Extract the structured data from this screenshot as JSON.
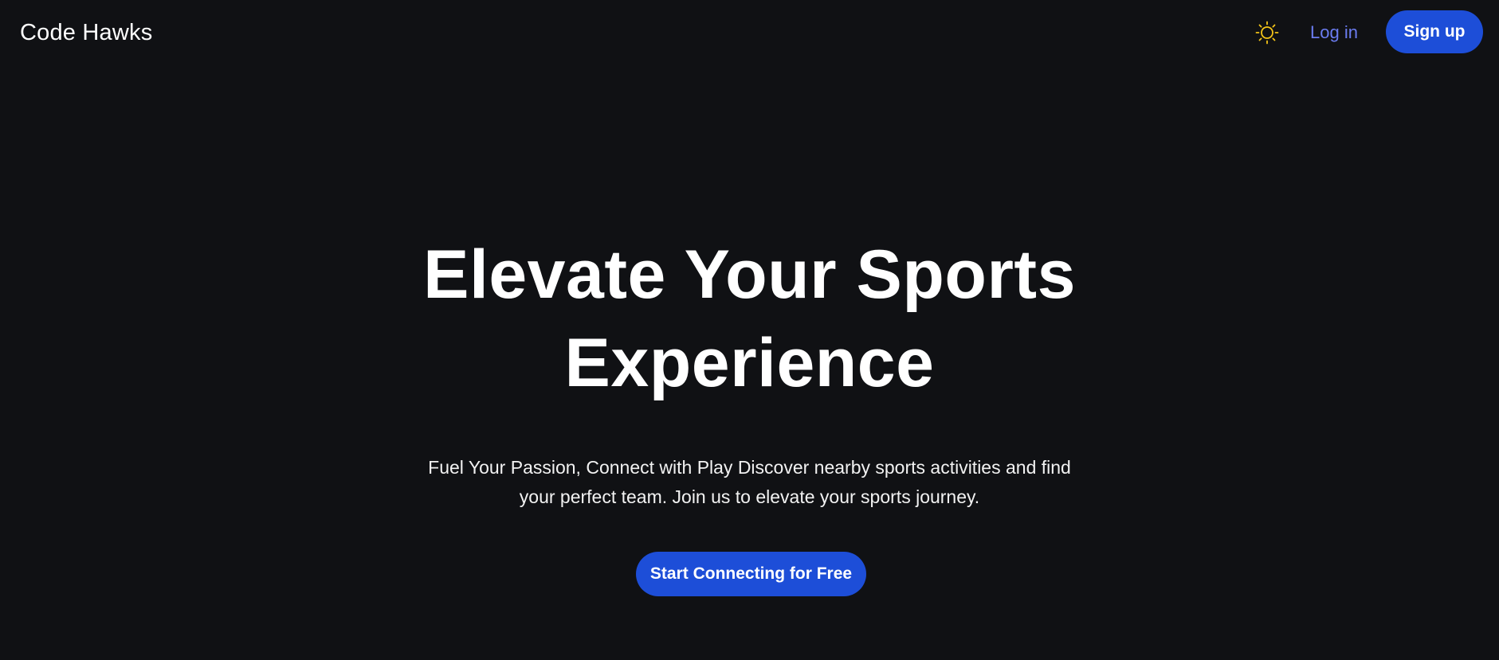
{
  "header": {
    "brand": "Code Hawks",
    "theme_toggle_icon": "sun-icon",
    "theme_icon_color": "#f5c518",
    "login_label": "Log in",
    "signup_label": "Sign up"
  },
  "hero": {
    "title": "Elevate Your Sports Experience",
    "subtitle": "Fuel Your Passion, Connect with Play Discover nearby sports activities and find your perfect team. Join us to elevate your sports journey.",
    "cta_label": "Start Connecting for Free"
  },
  "colors": {
    "background": "#101114",
    "accent": "#1d4ed8",
    "link": "#6b7cf0",
    "text": "#ffffff"
  }
}
